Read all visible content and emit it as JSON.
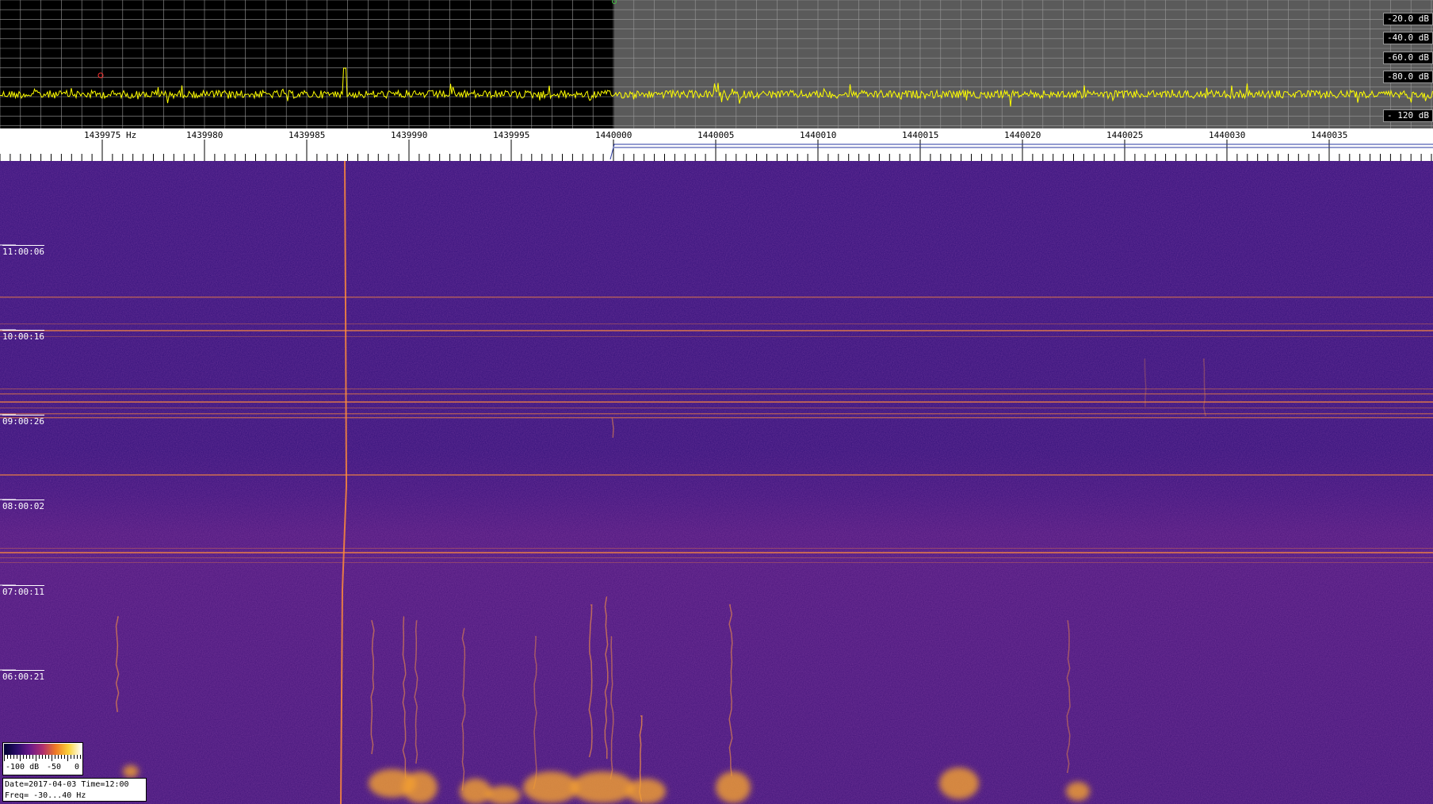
{
  "spectrum": {
    "trace_color": "#ffff00",
    "grid_color": "#9a9a9a",
    "left_bg": "#000000",
    "right_bg": "#5a5a5a",
    "db_labels": [
      "-20.0 dB",
      "-40.0 dB",
      "-60.0 dB",
      "-80.0 dB",
      "- 120 dB"
    ]
  },
  "frequency_axis": {
    "labels": [
      "1439975 Hz",
      "1439980",
      "1439985",
      "1439990",
      "1439995",
      "1440000",
      "1440005",
      "1440010",
      "1440015",
      "1440020",
      "1440025",
      "1440030",
      "1440035"
    ]
  },
  "waterfall": {
    "time_labels": [
      "11:00:06",
      "10:00:16",
      "09:00:26",
      "08:00:02",
      "07:00:11",
      "06:00:21"
    ]
  },
  "colorbar": {
    "labels": [
      "-100 dB",
      "-50",
      "0"
    ]
  },
  "info": {
    "line1": "Date=2017-04-03 Time=12:00",
    "line2": "Freq= -30...40 Hz"
  }
}
